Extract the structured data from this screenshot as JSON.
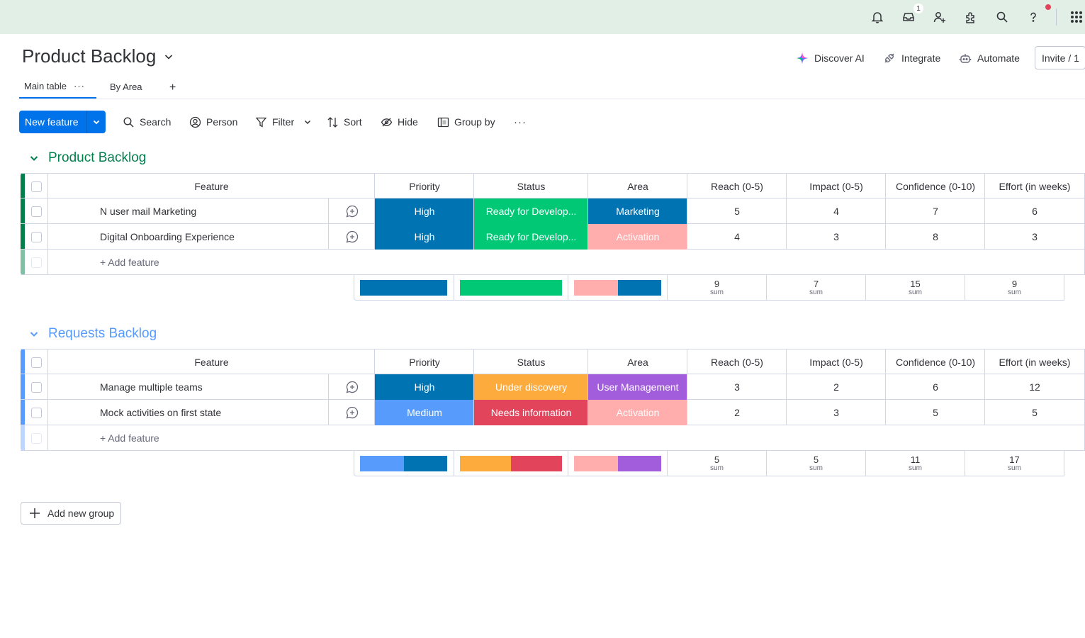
{
  "topbar": {
    "icons": [
      "bell-icon",
      "inbox-icon",
      "invite-person-icon",
      "apps-puzzle-icon",
      "search-icon",
      "help-icon",
      "grid-menu-icon"
    ],
    "inbox_count": "1",
    "bg": "#e2efe6"
  },
  "header": {
    "title": "Product Backlog",
    "discover_ai": "Discover AI",
    "integrate": "Integrate",
    "automate": "Automate",
    "invite": "Invite / 1"
  },
  "tabs": [
    {
      "label": "Main table",
      "active": true
    },
    {
      "label": "By Area",
      "active": false
    }
  ],
  "tabs_more": "···",
  "tabs_add": "+",
  "toolbar": {
    "new_label": "New feature",
    "search": "Search",
    "person": "Person",
    "filter": "Filter",
    "sort": "Sort",
    "hide": "Hide",
    "group_by": "Group by",
    "more": "···"
  },
  "columns": {
    "feature": "Feature",
    "priority": "Priority",
    "status": "Status",
    "area": "Area",
    "reach": "Reach (0-5)",
    "impact": "Impact (0-5)",
    "confidence": "Confidence (0-10)",
    "effort": "Effort (in weeks)"
  },
  "colors": {
    "priority_high": "#0073b3",
    "priority_medium": "#579bfc",
    "status_ready": "#00c875",
    "status_discovery": "#fdab3d",
    "status_needs_info": "#e2445c",
    "area_marketing": "#0073b3",
    "area_activation": "#ffadad",
    "area_user_mgmt": "#a25ddc",
    "group1": "#037f4c",
    "group2": "#579bfc",
    "accent": "#0073ea"
  },
  "groups": [
    {
      "title": "Product Backlog",
      "rows": [
        {
          "feature": "N user mail Marketing",
          "priority": "High",
          "status": "Ready for Develop...",
          "area": "Marketing",
          "reach": "5",
          "impact": "4",
          "confidence": "7",
          "effort": "6"
        },
        {
          "feature": "Digital Onboarding Experience",
          "priority": "High",
          "status": "Ready for Develop...",
          "area": "Activation",
          "reach": "4",
          "impact": "3",
          "confidence": "8",
          "effort": "3"
        }
      ],
      "add_label": "+ Add feature",
      "sums": {
        "reach": "9",
        "impact": "7",
        "confidence": "15",
        "effort": "9"
      },
      "sum_label": "sum"
    },
    {
      "title": "Requests Backlog",
      "rows": [
        {
          "feature": "Manage multiple teams",
          "priority": "High",
          "status": "Under discovery",
          "area": "User Management",
          "reach": "3",
          "impact": "2",
          "confidence": "6",
          "effort": "12"
        },
        {
          "feature": "Mock activities on first state",
          "priority": "Medium",
          "status": "Needs information",
          "area": "Activation",
          "reach": "2",
          "impact": "3",
          "confidence": "5",
          "effort": "5"
        }
      ],
      "add_label": "+ Add feature",
      "sums": {
        "reach": "5",
        "impact": "5",
        "confidence": "11",
        "effort": "17"
      },
      "sum_label": "sum"
    }
  ],
  "add_group": "Add new group"
}
